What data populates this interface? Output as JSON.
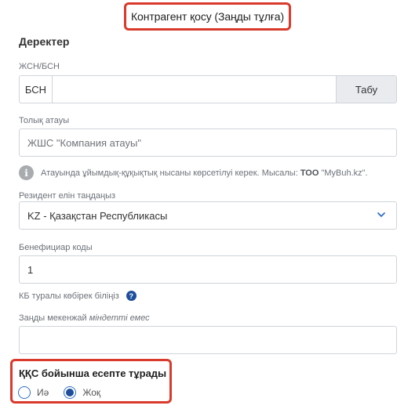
{
  "dialog_title": "Контрагент қосу (Заңды тұлға)",
  "section_title": "Деректер",
  "iin_bin": {
    "label": "ЖСН/БСН",
    "prefix": "БСН",
    "value": "",
    "button_label": "Табу"
  },
  "full_name": {
    "label": "Толық атауы",
    "placeholder": "ЖШС \"Компания атауы\""
  },
  "hint": {
    "text_before": "Атауында ұйымдық-құқықтық нысаны көрсетілуі керек. Мысалы: ",
    "bold": "ТОО",
    "text_after": " \"MyBuh.kz\"."
  },
  "resident_country": {
    "label": "Резидент елін таңдаңыз",
    "selected": "KZ - Қазақстан Республикасы"
  },
  "beneficiary_code": {
    "label": "Бенефициар коды",
    "value": "1"
  },
  "kb_help": {
    "text": "КБ туралы көбірек біліңіз",
    "icon": "?"
  },
  "legal_address": {
    "label": "Заңды мекенжай",
    "optional": "міндетті емес",
    "value": ""
  },
  "vat": {
    "title": "ҚҚС бойынша есепте тұрады",
    "options": [
      {
        "label": "Иә",
        "checked": false
      },
      {
        "label": "Жоқ",
        "checked": true
      }
    ]
  },
  "colors": {
    "highlight": "#d93a2b",
    "accent": "#1e4f9c"
  }
}
